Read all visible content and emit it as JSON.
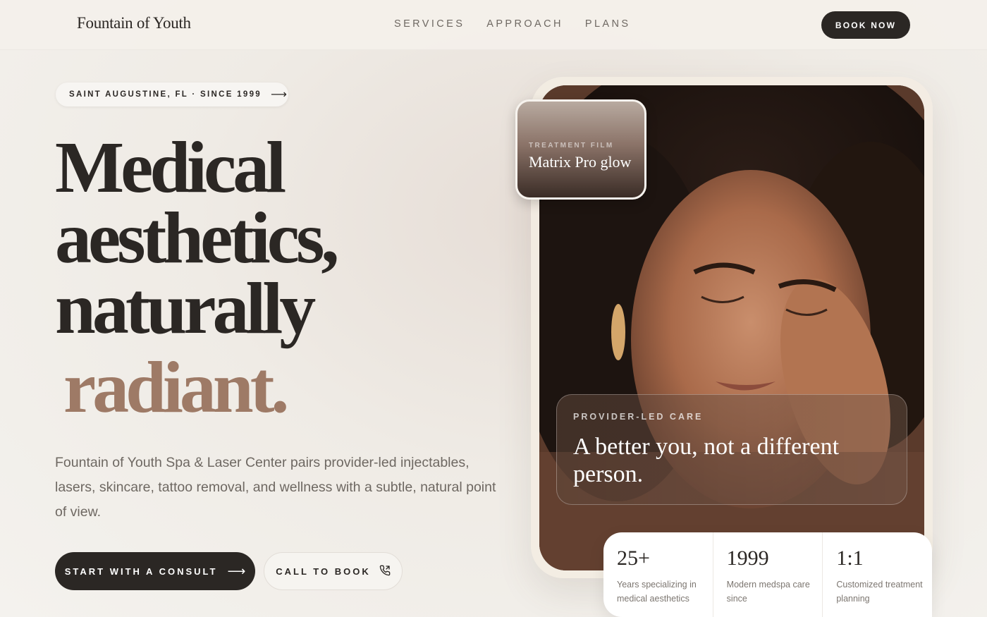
{
  "header": {
    "brand": "Fountain of Youth",
    "nav": [
      "SERVICES",
      "APPROACH",
      "PLANS"
    ],
    "book_label": "BOOK NOW"
  },
  "hero": {
    "location": "SAINT AUGUSTINE, FL · SINCE 1999",
    "headline_lines": [
      "Medical",
      "aesthetics,",
      "naturally"
    ],
    "headline_accent": "radiant.",
    "lead": "Fountain of Youth Spa & Laser Center pairs provider-led injectables, lasers, skincare, tattoo removal, and wellness with a subtle, natural point of view.",
    "cta_primary": "START WITH A CONSULT",
    "cta_secondary": "CALL TO BOOK"
  },
  "media": {
    "thumb_kicker": "TREATMENT FILM",
    "thumb_title": "Matrix Pro glow",
    "quote_kicker": "PROVIDER-LED CARE",
    "quote": "A better you, not a different person."
  },
  "stats": [
    {
      "num": "25+",
      "desc": "Years specializing in medical aesthetics"
    },
    {
      "num": "1999",
      "desc": "Modern medspa care since"
    },
    {
      "num": "1:1",
      "desc": "Customized treatment planning"
    }
  ],
  "colors": {
    "ink": "#2b2724",
    "accent": "#9e7a66",
    "muted": "#6e6862"
  },
  "icons": [
    "arrow-right-icon",
    "phone-icon"
  ]
}
